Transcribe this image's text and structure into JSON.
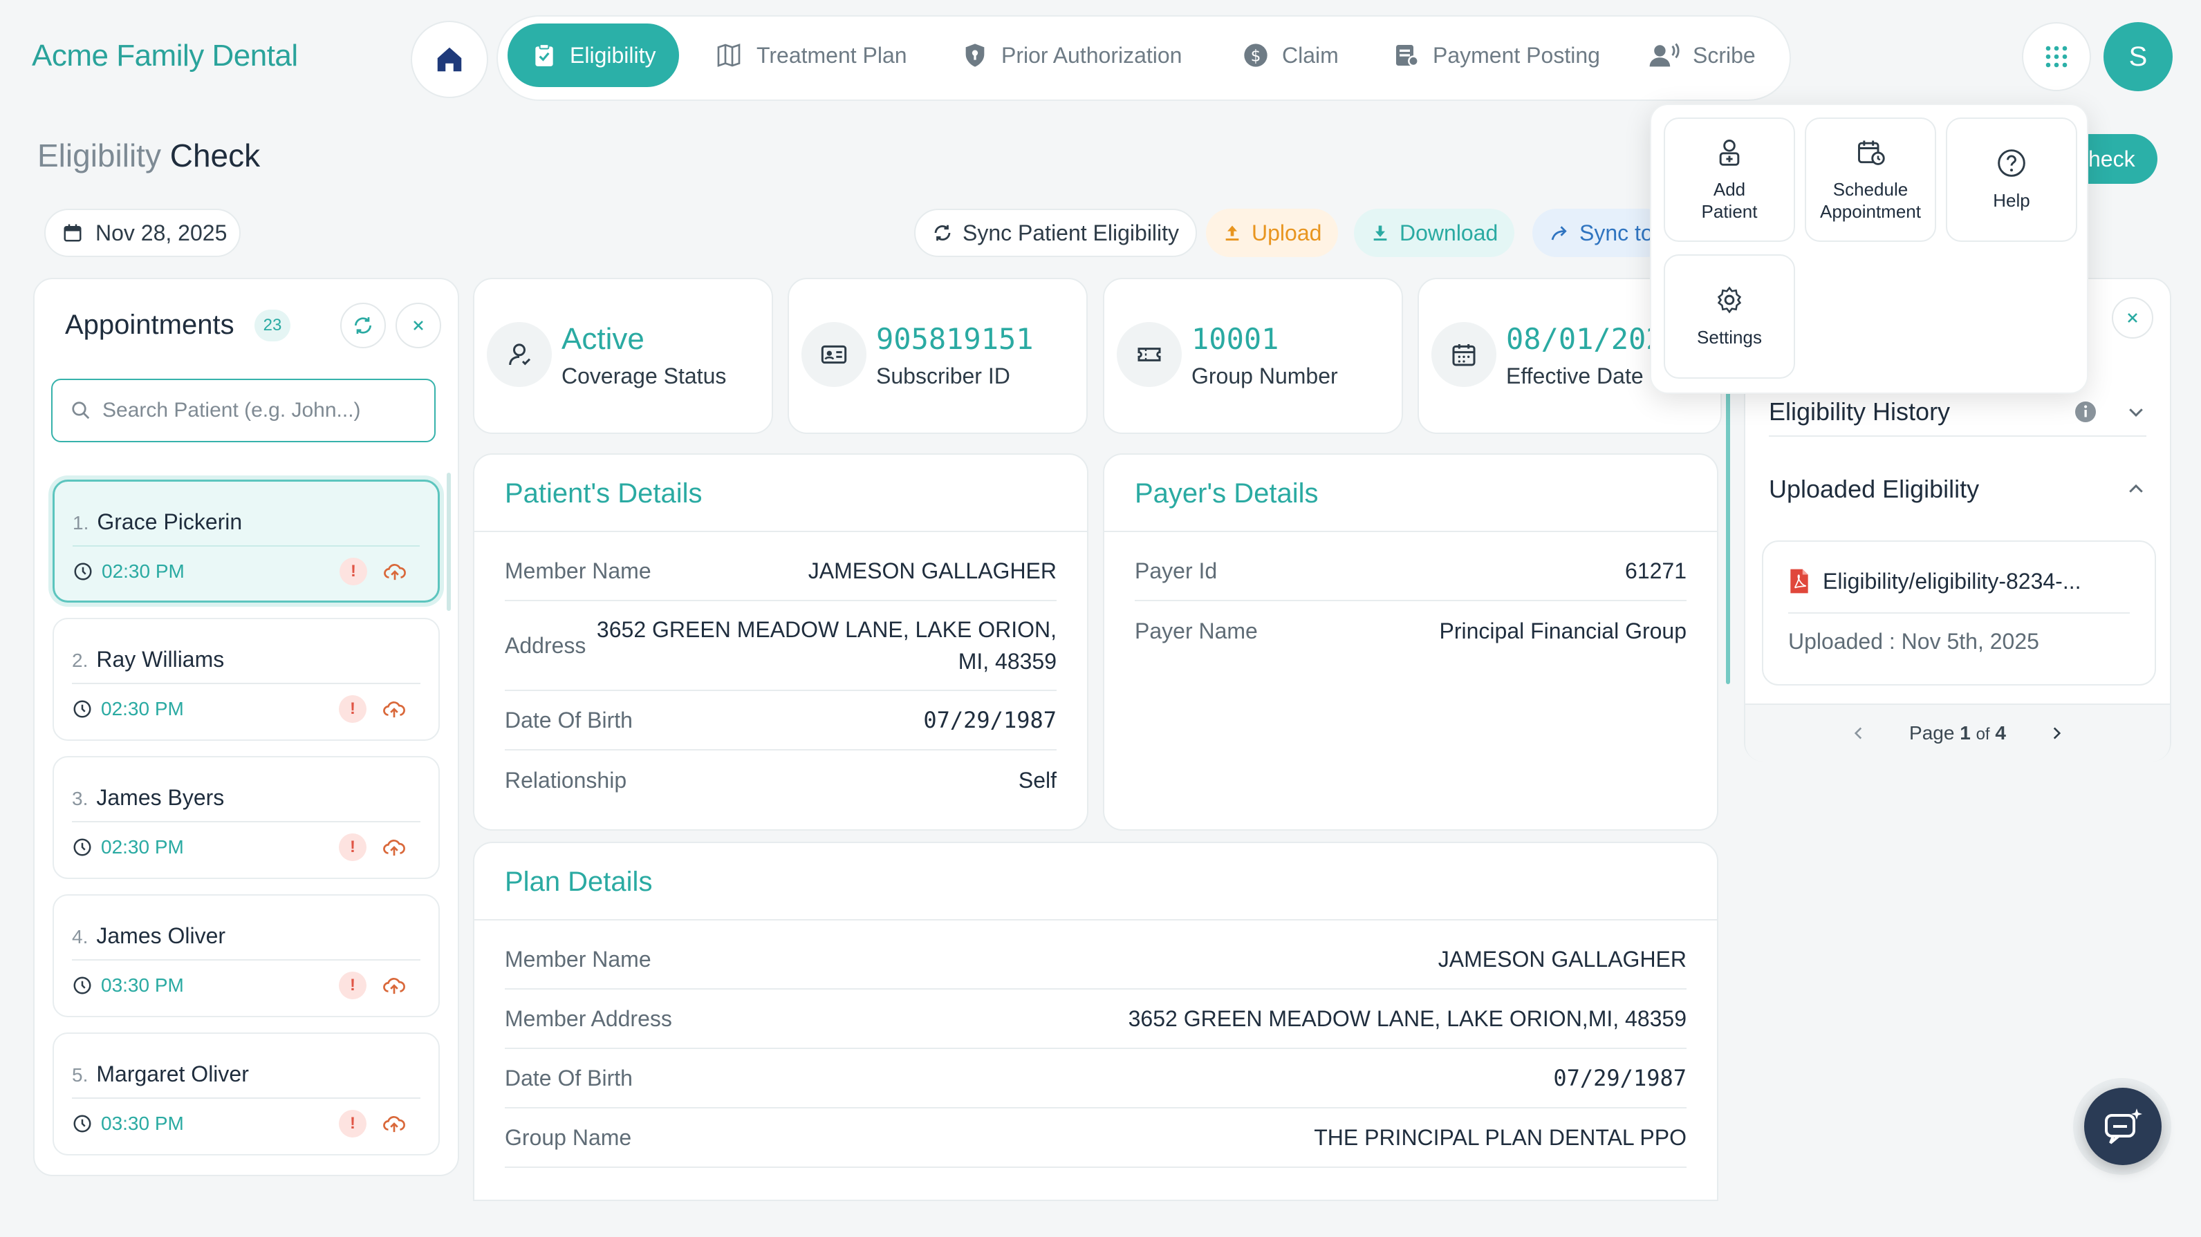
{
  "header": {
    "brand": "Acme Family Dental",
    "nav": [
      {
        "label": "Eligibility",
        "icon": "clipboard-icon",
        "active": true
      },
      {
        "label": "Treatment Plan",
        "icon": "map-icon"
      },
      {
        "label": "Prior Authorization",
        "icon": "shield-icon"
      },
      {
        "label": "Claim",
        "icon": "dollar-icon"
      },
      {
        "label": "Payment Posting",
        "icon": "receipt-icon"
      },
      {
        "label": "Scribe",
        "icon": "user-voice-icon"
      }
    ],
    "avatar_initial": "S"
  },
  "page": {
    "title_light": "Eligibility",
    "title_bold": "Check",
    "new_check_label": "heck",
    "date": "Nov 28, 2025"
  },
  "actions": {
    "sync": "Sync Patient Eligibility",
    "upload": "Upload",
    "download": "Download",
    "sync_to": "Sync to"
  },
  "appointments": {
    "title": "Appointments",
    "count": "23",
    "search_placeholder": "Search Patient (e.g. John...)",
    "items": [
      {
        "num": "1.",
        "name": "Grace Pickerin",
        "time": "02:30 PM"
      },
      {
        "num": "2.",
        "name": "Ray Williams",
        "time": "02:30 PM"
      },
      {
        "num": "3.",
        "name": "James Byers",
        "time": "02:30 PM"
      },
      {
        "num": "4.",
        "name": "James Oliver",
        "time": "03:30 PM"
      },
      {
        "num": "5.",
        "name": "Margaret Oliver",
        "time": "03:30 PM"
      }
    ]
  },
  "stats": [
    {
      "value": "Active",
      "label": "Coverage Status"
    },
    {
      "value": "905819151",
      "label": "Subscriber ID"
    },
    {
      "value": "10001",
      "label": "Group Number"
    },
    {
      "value": "08/01/202",
      "label": "Effective Date"
    }
  ],
  "patient_details": {
    "title": "Patient's Details",
    "rows": [
      {
        "key": "Member Name",
        "value": "JAMESON GALLAGHER"
      },
      {
        "key": "Address",
        "value": "3652 GREEN MEADOW LANE, LAKE ORION,",
        "value2": "MI, 48359"
      },
      {
        "key": "Date Of Birth",
        "value": "07/29/1987"
      },
      {
        "key": "Relationship",
        "value": "Self"
      }
    ]
  },
  "payer_details": {
    "title": "Payer's Details",
    "rows": [
      {
        "key": "Payer Id",
        "value": "61271"
      },
      {
        "key": "Payer Name",
        "value": "Principal Financial Group"
      }
    ]
  },
  "plan_details": {
    "title": "Plan Details",
    "rows": [
      {
        "key": "Member Name",
        "value": "JAMESON GALLAGHER"
      },
      {
        "key": "Member Address",
        "value": "3652 GREEN MEADOW LANE, LAKE ORION,MI, 48359"
      },
      {
        "key": "Date Of Birth",
        "value": "07/29/1987"
      },
      {
        "key": "Group Name",
        "value": "THE PRINCIPAL PLAN DENTAL PPO"
      }
    ]
  },
  "right_panel": {
    "history_title": "Eligibility History",
    "uploaded_title": "Uploaded Eligibility",
    "file_name": "Eligibility/eligibility-8234-...",
    "uploaded_on": "Uploaded : Nov 5th, 2025",
    "page_prefix": "Page",
    "page_current": "1",
    "page_of": "of",
    "page_total": "4"
  },
  "apps_menu": {
    "add_patient": [
      "Add",
      "Patient"
    ],
    "schedule": [
      "Schedule",
      "Appointment"
    ],
    "help": "Help",
    "settings": "Settings"
  },
  "colors": {
    "accent": "#2bb0a8",
    "brand_text": "#2aa39b",
    "warning": "#e05545",
    "upload": "#e8951f",
    "sync_to": "#2f74c0",
    "chat": "#2a3b55"
  }
}
